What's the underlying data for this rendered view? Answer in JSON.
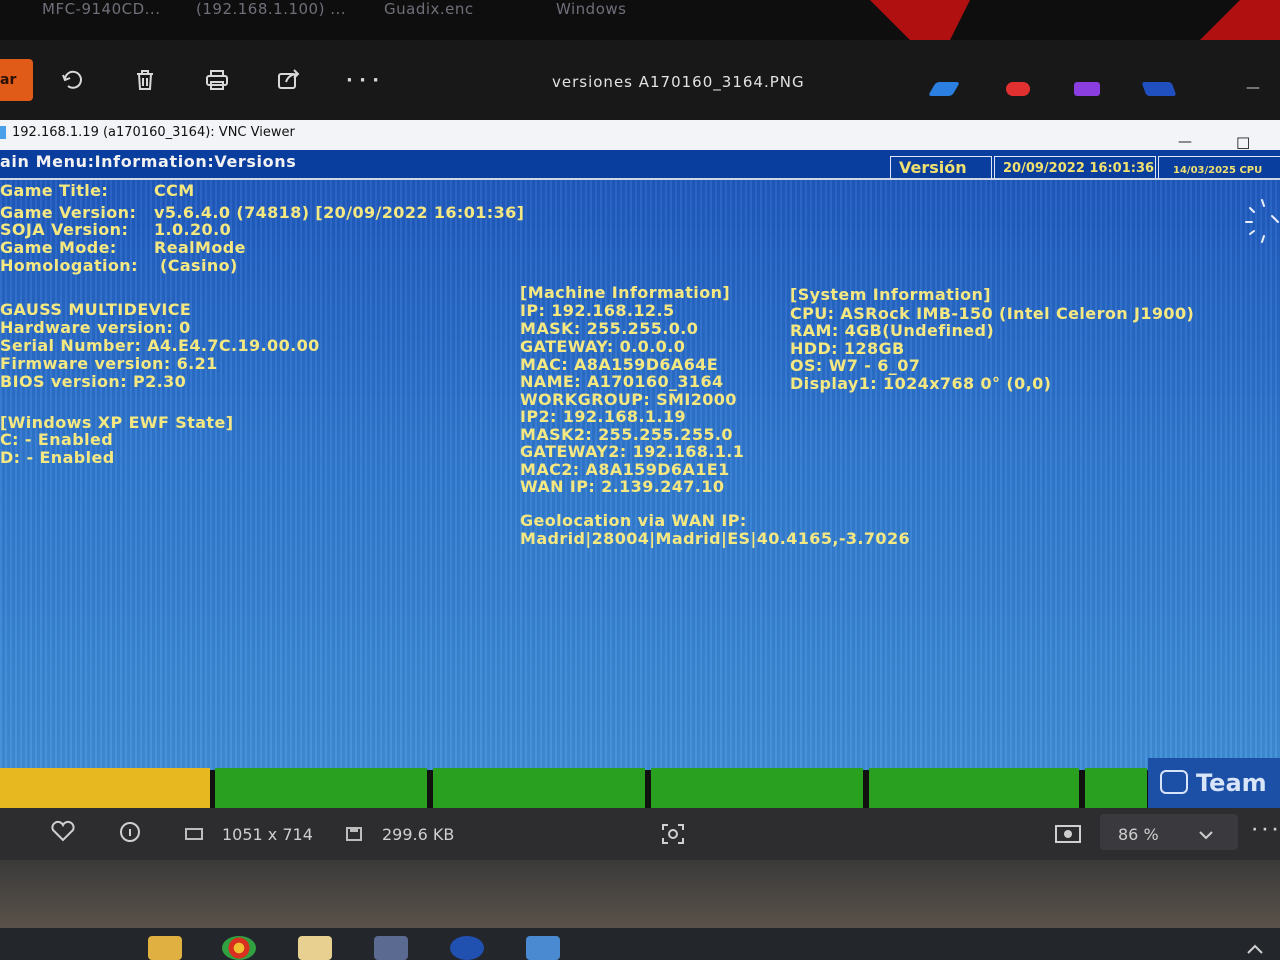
{
  "top_strip": {
    "items": [
      "MFC-9140CD...",
      "(192.168.1.100) ...",
      "Guadix.enc",
      "Windows"
    ]
  },
  "photos_toolbar": {
    "edit_label": "ar",
    "file_title": "versiones A170160_3164.PNG",
    "more_label": "· · ·",
    "minimize_label": "—"
  },
  "vnc": {
    "window_title": "192.168.1.19 (a170160_3164): VNC Viewer",
    "minimize_label": "—",
    "maximize_label": "☐"
  },
  "header": {
    "menu_path": "ain Menu:Information:Versions",
    "version_label": "Versión",
    "datetime": "20/09/2022 16:01:36",
    "date2": "14/03/2025",
    "cpu_label": "CPU"
  },
  "game": {
    "title_label": "Game Title:",
    "title_value": "CCM",
    "version_label": "Game Version:",
    "version_value": "v5.6.4.0 (74818) [20/09/2022 16:01:36]",
    "soja_label": "SOJA Version:",
    "soja_value": "1.0.20.0",
    "mode_label": "Game Mode:",
    "mode_value": "RealMode",
    "homologation_label": "Homologation:",
    "homologation_value": "(Casino)"
  },
  "device": {
    "name": "GAUSS MULTIDEVICE",
    "hardware": "Hardware version: 0",
    "serial": "Serial Number: A4.E4.7C.19.00.00",
    "firmware": "Firmware version: 6.21",
    "bios": "BIOS version: P2.30"
  },
  "ewf": {
    "title": "[Windows XP EWF State]",
    "c": "C: - Enabled",
    "d": "D: - Enabled"
  },
  "machine": {
    "title": "[Machine Information]",
    "lines": [
      "IP: 192.168.12.5",
      "MASK: 255.255.0.0",
      "GATEWAY: 0.0.0.0",
      "MAC: A8A159D6A64E",
      "NAME: A170160_3164",
      "WORKGROUP: SMI2000",
      "IP2: 192.168.1.19",
      "MASK2: 255.255.255.0",
      "GATEWAY2: 192.168.1.1",
      "MAC2: A8A159D6A1E1",
      "WAN IP: 2.139.247.10"
    ],
    "geo_title": "Geolocation via WAN IP:",
    "geo_value": "Madrid|28004|Madrid|ES|40.4165,-3.7026"
  },
  "system": {
    "title": "[System Information]",
    "lines": [
      "CPU: ASRock IMB-150 (Intel Celeron J1900)",
      "RAM: 4GB(Undefined)",
      "HDD: 128GB",
      "OS: W7 - 6_07",
      "Display1: 1024x768 0° (0,0)"
    ]
  },
  "teamviewer_label": "Team",
  "info_bar": {
    "dimensions": "1051 x 714",
    "file_size": "299.6 KB",
    "zoom": "86 %",
    "more_label": "· · ·"
  },
  "colors": {
    "screen_blue": "#2f78d0",
    "header_blue": "#0a3e9e",
    "text_yellow": "#f6e880",
    "button_yellow": "#e8b820",
    "button_green": "#2aa020",
    "edit_orange": "#e05a18"
  },
  "icons": [
    "rotate-icon",
    "trash-icon",
    "print-icon",
    "share-icon",
    "heart-icon",
    "info-icon",
    "dimensions-icon",
    "save-icon",
    "crop-icon",
    "fit-screen-icon",
    "chevron-down-icon"
  ]
}
